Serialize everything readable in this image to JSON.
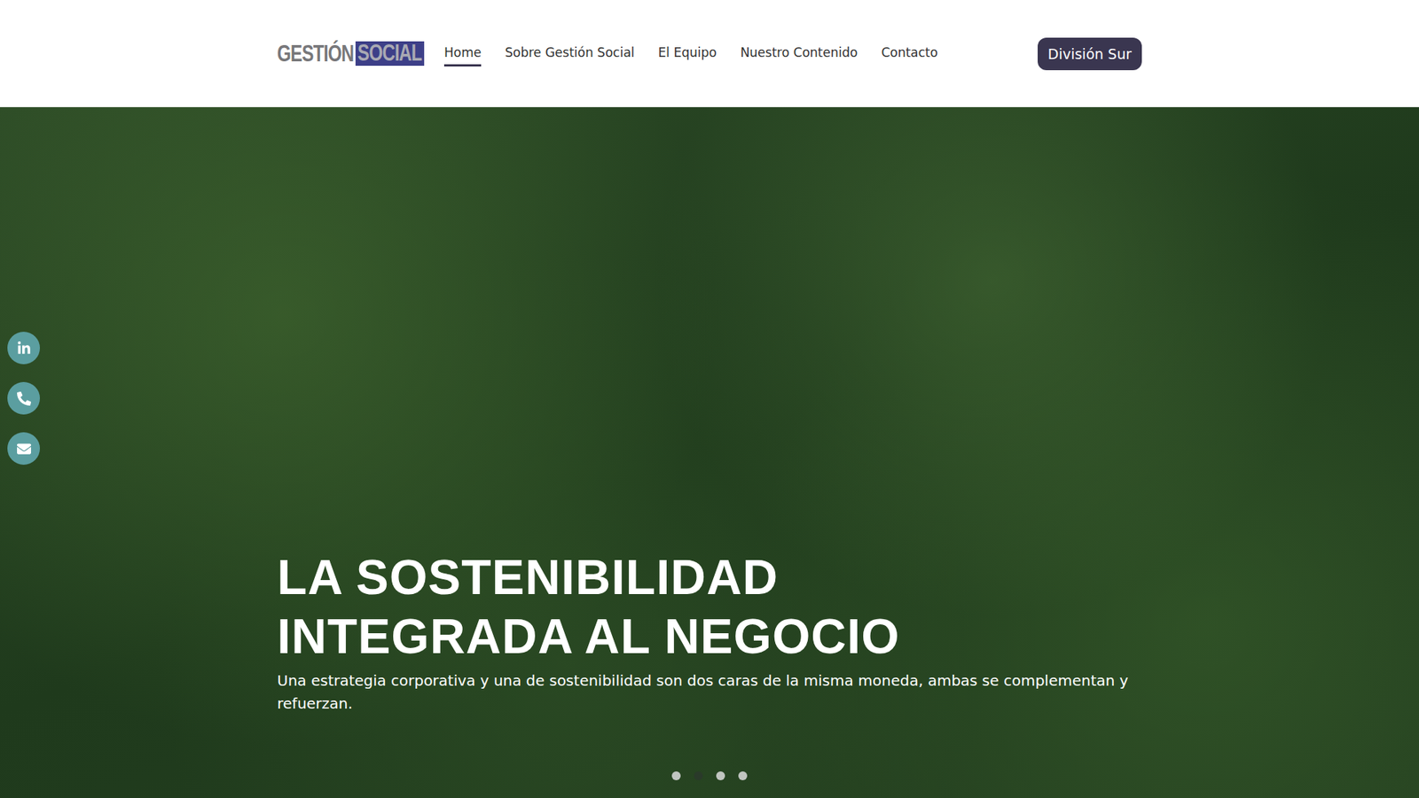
{
  "logo": {
    "first": "GESTIÓN",
    "second": "SOCIAL"
  },
  "nav": [
    {
      "label": "Home",
      "selected": true
    },
    {
      "label": "Sobre Gestión Social",
      "selected": false
    },
    {
      "label": "El Equipo",
      "selected": false
    },
    {
      "label": "Nuestro Contenido",
      "selected": false
    },
    {
      "label": "Contacto",
      "selected": false
    }
  ],
  "division_button": "División Sur",
  "social": [
    {
      "kind": "linkedin"
    },
    {
      "kind": "phone"
    },
    {
      "kind": "mail"
    }
  ],
  "hero": {
    "title_lines": [
      "LA SOSTENIBILIDAD",
      "INTEGRADA AL NEGOCIO"
    ],
    "subtitle": "Una estrategia corporativa y una de sostenibilidad son dos caras de la misma moneda, ambas se complementan y refuerzan."
  },
  "carousel_dots": [
    {
      "selected": false
    },
    {
      "selected": true
    },
    {
      "selected": false
    },
    {
      "selected": false
    }
  ]
}
